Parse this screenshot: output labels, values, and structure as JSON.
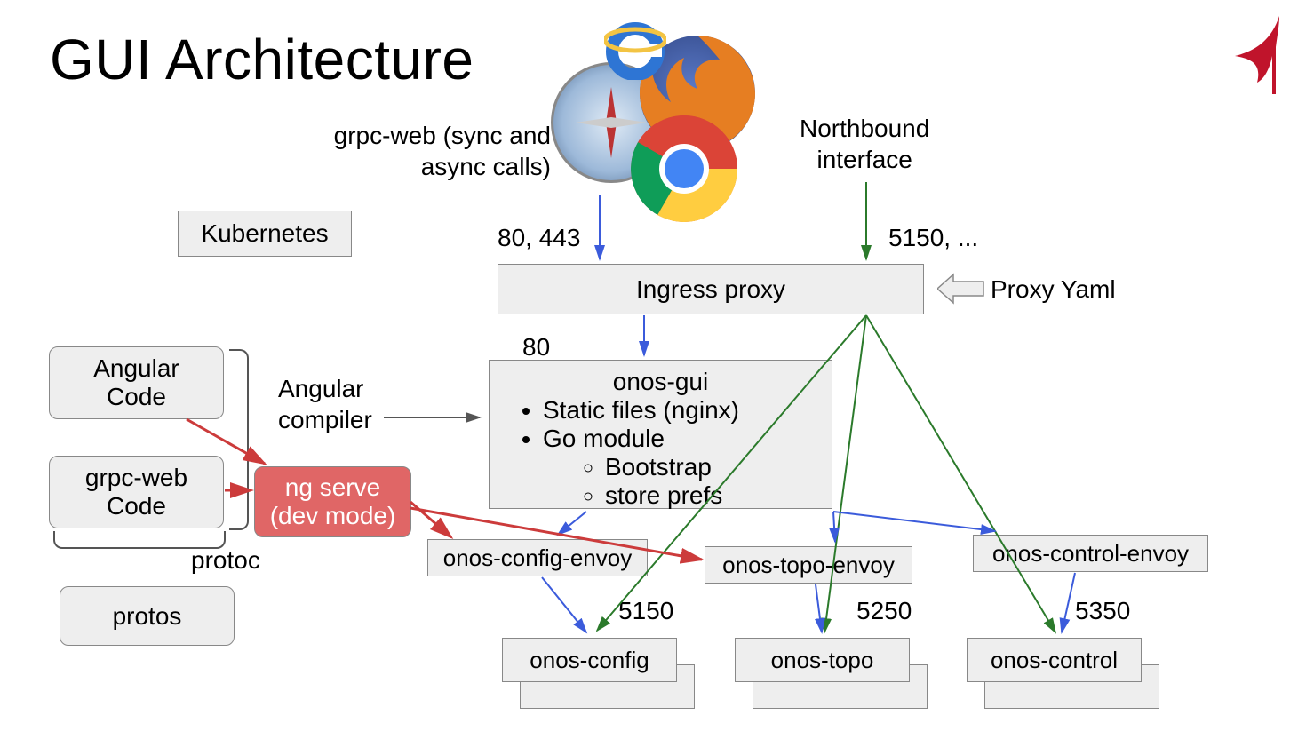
{
  "title": "GUI Architecture",
  "labels": {
    "grpcweb_calls": "grpc-web (sync and\nasync calls)",
    "northbound": "Northbound\ninterface",
    "ports_left": "80, 443",
    "ports_right": "5150, ...",
    "kubernetes": "Kubernetes",
    "ingress": "Ingress proxy",
    "proxy_yaml": "Proxy Yaml",
    "port80": "80",
    "angular_code_1": "Angular",
    "angular_code_2": "Code",
    "grpcweb_code_1": "grpc-web",
    "grpcweb_code_2": "Code",
    "protos": "protos",
    "protoc": "protoc",
    "angular_compiler": "Angular\ncompiler",
    "ng_serve_1": "ng serve",
    "ng_serve_2": "(dev mode)",
    "gui_title": "onos-gui",
    "gui_b1": "Static files (nginx)",
    "gui_b2": "Go module",
    "gui_s1": "Bootstrap",
    "gui_s2": "store prefs",
    "envoy_config": "onos-config-envoy",
    "envoy_topo": "onos-topo-envoy",
    "envoy_control": "onos-control-envoy",
    "svc_config": "onos-config",
    "svc_topo": "onos-topo",
    "svc_control": "onos-control",
    "p5150": "5150",
    "p5250": "5250",
    "p5350": "5350"
  }
}
